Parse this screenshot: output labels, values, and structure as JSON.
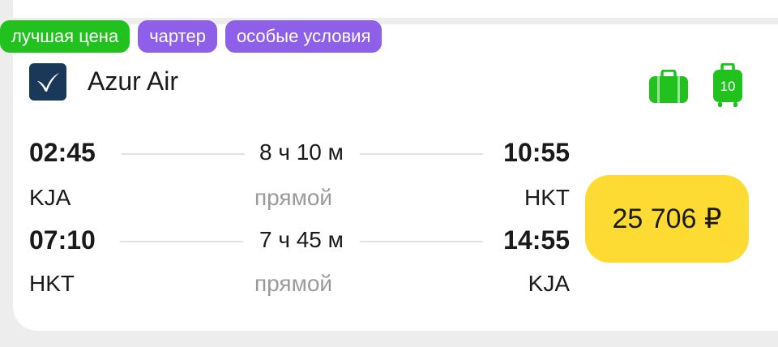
{
  "badges": [
    {
      "label": "лучшая цена",
      "color": "#21c11e"
    },
    {
      "label": "чартер",
      "color": "#8e5fe8"
    },
    {
      "label": "особые условия",
      "color": "#8e5fe8"
    }
  ],
  "airline": {
    "name": "Azur Air",
    "logo_icon": "azur-air-logo",
    "logo_color": "#1a3857"
  },
  "baggage": {
    "hand_luggage_icon": "briefcase-icon",
    "checked_luggage_icon": "suitcase-icon",
    "checked_weight": "10",
    "color": "#21c11e"
  },
  "segments": [
    {
      "depart_time": "02:45",
      "duration": "8 ч 10 м",
      "arrive_time": "10:55",
      "from": "KJA",
      "type": "прямой",
      "to": "HKT"
    },
    {
      "depart_time": "07:10",
      "duration": "7 ч 45 м",
      "arrive_time": "14:55",
      "from": "HKT",
      "type": "прямой",
      "to": "KJA"
    }
  ],
  "price": {
    "value": "25 706 ₽",
    "color": "#fddb32"
  }
}
